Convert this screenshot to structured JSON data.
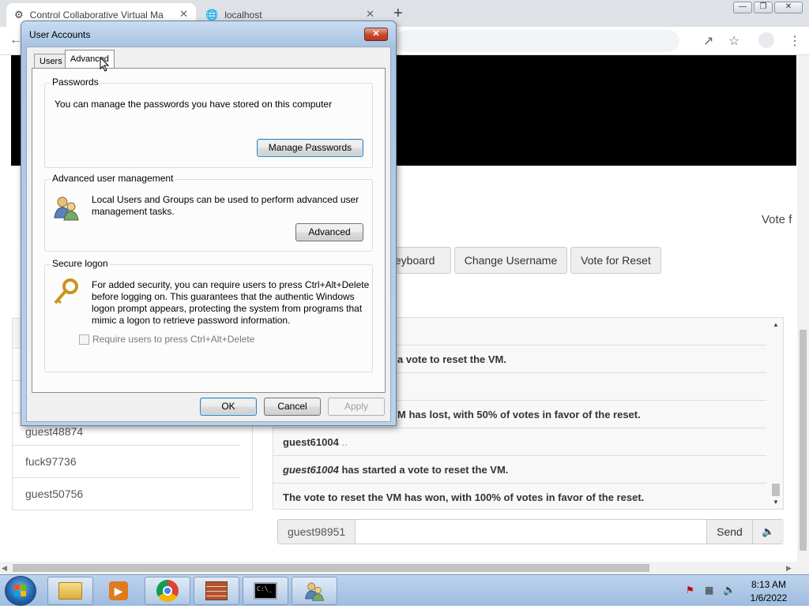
{
  "browser": {
    "tabs": [
      {
        "title": "Control Collaborative Virtual Ma"
      },
      {
        "title": "localhost"
      }
    ]
  },
  "page": {
    "vote_label": "Vote f",
    "buttons": [
      "Keyboard",
      "Change Username",
      "Vote for Reset"
    ],
    "users": [
      "guest48874",
      "fuck97736",
      "guest50756"
    ],
    "chat": [
      {
        "user": "",
        "text": "a vote to reset the VM."
      },
      {
        "user": "",
        "text": ""
      },
      {
        "user": "",
        "text": "M has lost, with 50% of votes in favor of the reset."
      },
      {
        "user": "guest61004",
        "text": " .."
      },
      {
        "user": "guest61004",
        "text": " has started a vote to reset the VM."
      },
      {
        "user": "",
        "text": "The vote to reset the VM has won, with 100% of votes in favor of the reset."
      }
    ],
    "chat_username": "guest98951",
    "send_label": "Send"
  },
  "dialog": {
    "title": "User Accounts",
    "tabs": [
      "Users",
      "Advanced"
    ],
    "passwords": {
      "label": "Passwords",
      "text": "You can manage the passwords you have stored on this computer",
      "button": "Manage Passwords"
    },
    "advanced_mgmt": {
      "label": "Advanced user management",
      "text": "Local Users and Groups can be used to perform advanced user management tasks.",
      "button": "Advanced"
    },
    "secure_logon": {
      "label": "Secure logon",
      "text": "For added security, you can require users to press Ctrl+Alt+Delete before logging on. This guarantees that the authentic Windows logon prompt appears, protecting the system from programs that mimic a logon to retrieve password information.",
      "checkbox": "Require users to press Ctrl+Alt+Delete",
      "checked": false
    },
    "buttons": {
      "ok": "OK",
      "cancel": "Cancel",
      "apply": "Apply"
    }
  },
  "taskbar": {
    "time": "8:13 AM",
    "date": "1/6/2022"
  }
}
